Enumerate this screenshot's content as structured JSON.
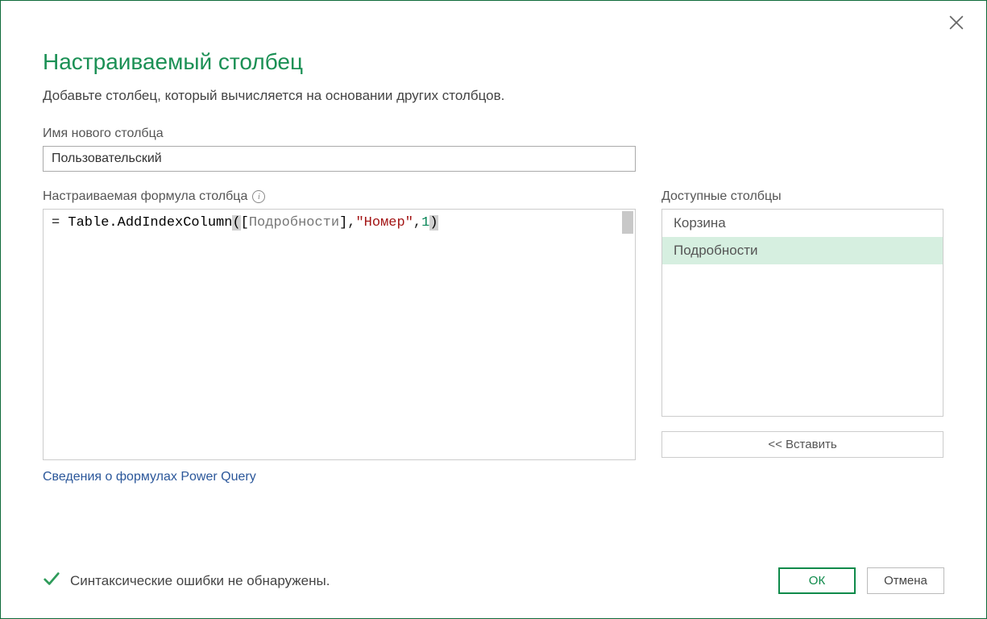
{
  "dialog": {
    "title": "Настраиваемый столбец",
    "subtitle": "Добавьте столбец, который вычисляется на основании других столбцов.",
    "column_name_label": "Имя нового столбца",
    "column_name_value": "Пользовательский",
    "formula_label": "Настраиваемая формула столбца",
    "available_columns_label": "Доступные столбцы",
    "insert_button": "<< Вставить",
    "help_link": "Сведения о формулах Power Query",
    "status_text": "Синтаксические ошибки не обнаружены.",
    "ok_button": "ОК",
    "cancel_button": "Отмена"
  },
  "formula": {
    "prefix": "= ",
    "func": "Table.AddIndexColumn",
    "open": "(",
    "ref_open": "[",
    "ref_name": "Подробности",
    "ref_close": "]",
    "sep1": ",",
    "string": "\"Номер\"",
    "sep2": ",",
    "number": "1",
    "close": ")"
  },
  "available_columns": {
    "items": [
      {
        "name": "Корзина",
        "selected": false
      },
      {
        "name": "Подробности",
        "selected": true
      }
    ]
  }
}
